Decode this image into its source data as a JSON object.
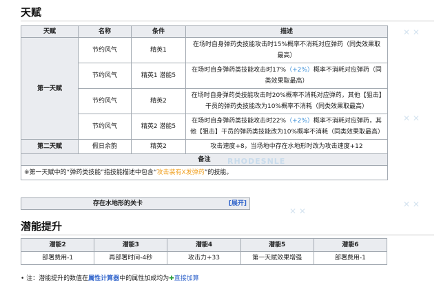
{
  "section_talent": {
    "heading": "天赋",
    "headers": [
      "天赋",
      "名称",
      "条件",
      "描述"
    ],
    "group1": "第一天赋",
    "group2": "第二天赋",
    "rows": [
      {
        "name": "节约风气",
        "cond": "精英1",
        "desc": "在场时自身弹药类技能攻击时15%概率不消耗对应弹药（同类效果取最高）"
      },
      {
        "name": "节约风气",
        "cond": "精英1 潜能5",
        "desc_a": "在场时自身弹药类技能攻击时17%",
        "desc_plus": "（+2%）",
        "desc_b": "概率不消耗对应弹药（同类效果取最高）"
      },
      {
        "name": "节约风气",
        "cond": "精英2",
        "desc": "在场时自身弹药类技能攻击时20%概率不消耗对应弹药，其他【狙击】干员的弹药类技能改为10%概率不消耗（同类效果取最高）"
      },
      {
        "name": "节约风气",
        "cond": "精英2 潜能5",
        "desc_a": "在场时自身弹药类技能攻击时22%",
        "desc_plus": "（+2%）",
        "desc_b": "概率不消耗对应弹药，其他【狙击】干员的弹药类技能改为10%概率不消耗（同类效果取最高）"
      },
      {
        "name": "假日余韵",
        "cond": "精英2",
        "desc": "攻击速度+8，当场地中存在水地形时改为攻击速度+12"
      }
    ],
    "note_header": "备注",
    "note_prefix": "※第一天赋中的“弹药类技能”指技能描述中包含“",
    "note_highlight": "攻击装有X发弹药",
    "note_suffix": "”的技能。"
  },
  "collapsible": {
    "title": "存在水地形的关卡",
    "toggle": "[展开]"
  },
  "section_potential": {
    "heading": "潜能提升",
    "headers": [
      "潜能2",
      "潜能3",
      "潜能4",
      "潜能5",
      "潜能6"
    ],
    "values": [
      "部署费用-1",
      "再部署时间-4秒",
      "攻击力+33",
      "第一天赋效果增强",
      "部署费用-1"
    ]
  },
  "footnote": {
    "prefix": "• 注：潜能提升的数值在",
    "bold": "属性计算器",
    "middle": "中的属性加成均为",
    "plus_icon": "✚",
    "link": "直接加算"
  },
  "watermark": "RHODESNLE"
}
